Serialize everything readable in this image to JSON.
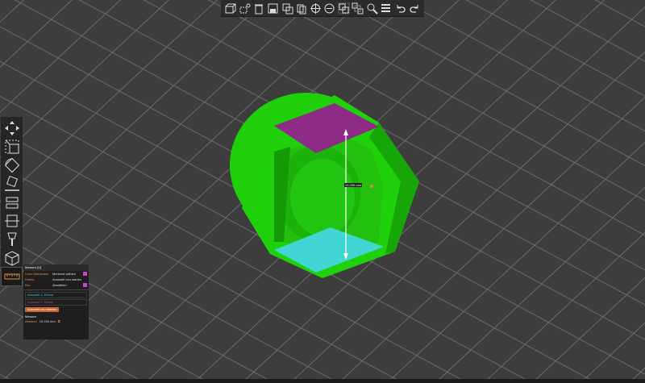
{
  "toolbar": {
    "tools": [
      {
        "icon": "add-cube-icon"
      },
      {
        "icon": "add-multiple-icon"
      },
      {
        "icon": "delete-icon"
      },
      {
        "icon": "save-icon"
      },
      {
        "icon": "duplicate-icon"
      },
      {
        "icon": "copy-icon"
      },
      {
        "icon": "crosshair-icon"
      },
      {
        "icon": "minus-circle-icon"
      },
      {
        "icon": "group-icon"
      },
      {
        "icon": "ungroup-icon"
      },
      {
        "icon": "zoom-icon"
      },
      {
        "icon": "layers-icon"
      },
      {
        "icon": "undo-icon"
      },
      {
        "icon": "redo-icon"
      }
    ]
  },
  "left_toolbar": {
    "tools": [
      {
        "icon": "move-icon"
      },
      {
        "icon": "scale-icon"
      },
      {
        "icon": "rotate-icon"
      },
      {
        "icon": "lay-flat-icon"
      },
      {
        "icon": "mirror-icon"
      },
      {
        "icon": "cut-icon"
      },
      {
        "icon": "support-icon"
      },
      {
        "icon": "cube-view-icon"
      },
      {
        "icon": "ruler-icon"
      }
    ]
  },
  "measure": {
    "title": "Messen [U]",
    "rows": [
      {
        "key": "Linke Maustaste",
        "value": "Merkmal wählen",
        "swatch": true
      },
      {
        "key": "Delete",
        "value": "Auswahl neu starten",
        "swatch": false
      },
      {
        "key": "Esc",
        "value": "Abwählen",
        "swatch": true
      }
    ],
    "selection1": "Auswahl 1:  Ebene",
    "selection2": "Auswahl 2:  Ebene",
    "restart_label": "Auswahl neu starten",
    "section_label": "Messen",
    "distance_key": "Abstand",
    "distance_value": "19,250 mm",
    "label_value": "19,250 mm"
  },
  "colors": {
    "background": "#3d3d3d",
    "grid": "#8a8a8a",
    "model": "#1fd10a",
    "model_dark": "#159a07",
    "top_face": "#8d2b86",
    "bottom_face": "#3fd6d3",
    "accent": "#e08a3c"
  }
}
